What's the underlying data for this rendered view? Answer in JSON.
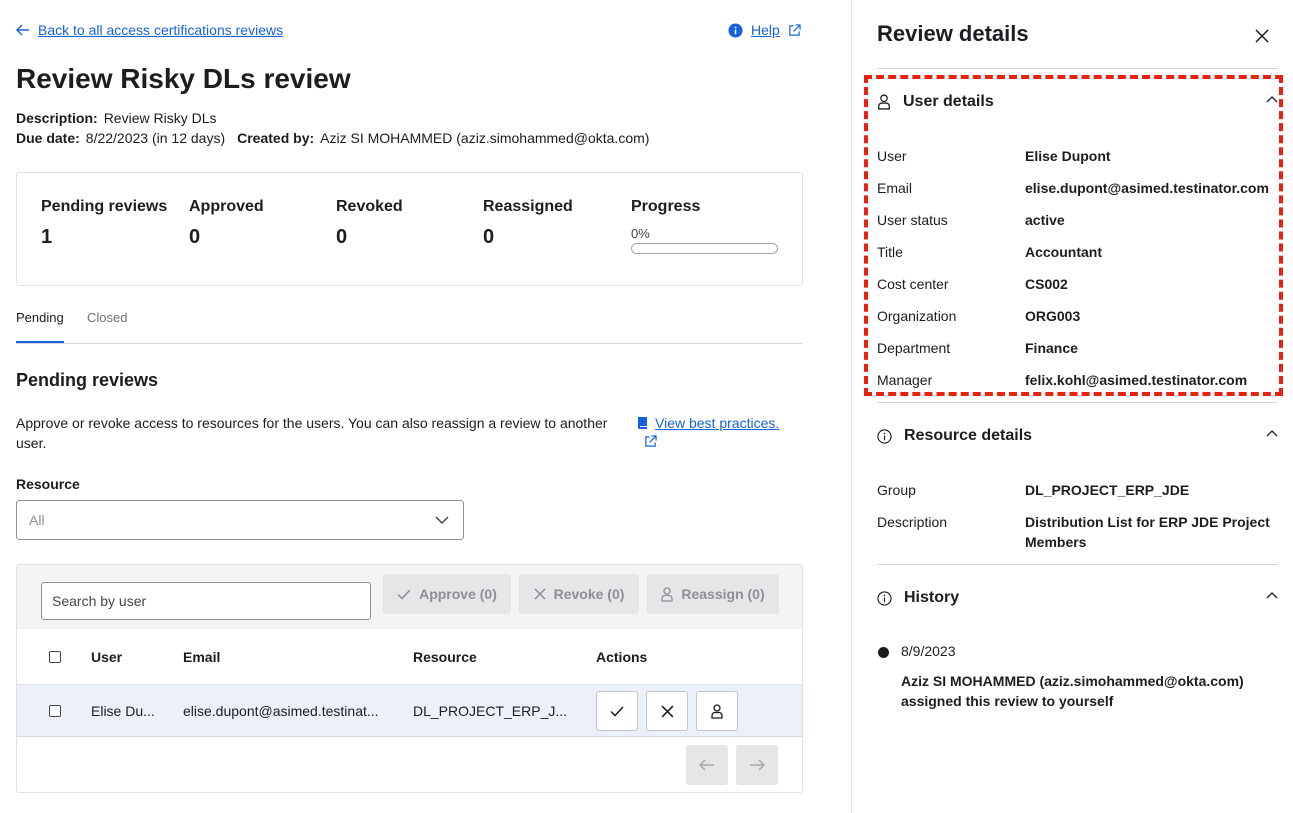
{
  "header": {
    "back_link": "Back to all access certifications reviews",
    "help_link": "Help",
    "title": "Review Risky DLs review"
  },
  "meta": {
    "description_label": "Description:",
    "description": "Review Risky DLs",
    "due_label": "Due date:",
    "due": "8/22/2023 (in 12 days)",
    "created_label": "Created by:",
    "created": "Aziz SI MOHAMMED (aziz.simohammed@okta.com)"
  },
  "stats": {
    "pending_label": "Pending reviews",
    "pending": "1",
    "approved_label": "Approved",
    "approved": "0",
    "revoked_label": "Revoked",
    "revoked": "0",
    "reassigned_label": "Reassigned",
    "reassigned": "0",
    "progress_label": "Progress",
    "progress_text": "0%",
    "progress_fraction": 0
  },
  "tabs": [
    "Pending",
    "Closed"
  ],
  "pending": {
    "title": "Pending reviews",
    "description": "Approve or revoke access to resources for the users. You can also reassign a review to another user.",
    "best_practices": "View best practices."
  },
  "filter": {
    "label": "Resource",
    "value": "All"
  },
  "toolbar": {
    "search_placeholder": "Search by user",
    "approve": "Approve (0)",
    "revoke": "Revoke (0)",
    "reassign": "Reassign (0)"
  },
  "table": {
    "columns": [
      "User",
      "Email",
      "Resource",
      "Actions"
    ],
    "rows": [
      {
        "user": "Elise Du...",
        "email": "elise.dupont@asimed.testinat...",
        "resource": "DL_PROJECT_ERP_J..."
      }
    ]
  },
  "panel": {
    "title": "Review details",
    "user_section": "User details",
    "user_details": [
      {
        "label": "User",
        "value": "Elise Dupont"
      },
      {
        "label": "Email",
        "value": "elise.dupont@asimed.testinator.com"
      },
      {
        "label": "User status",
        "value": "active"
      },
      {
        "label": "Title",
        "value": "Accountant"
      },
      {
        "label": "Cost center",
        "value": "CS002"
      },
      {
        "label": "Organization",
        "value": "ORG003"
      },
      {
        "label": "Department",
        "value": "Finance"
      },
      {
        "label": "Manager",
        "value": "felix.kohl@asimed.testinator.com"
      }
    ],
    "resource_section": "Resource details",
    "resource_details": [
      {
        "label": "Group",
        "value": "DL_PROJECT_ERP_JDE"
      },
      {
        "label": "Description",
        "value": "Distribution List for ERP JDE Project Members"
      }
    ],
    "history_section": "History",
    "history": [
      {
        "date": "8/9/2023",
        "text": "Aziz SI MOHAMMED (aziz.simohammed@okta.com) assigned this review to yourself"
      }
    ]
  },
  "colors": {
    "accent": "#1662dd",
    "highlight": "#e8220e",
    "row_selected": "#ebf0fa"
  }
}
